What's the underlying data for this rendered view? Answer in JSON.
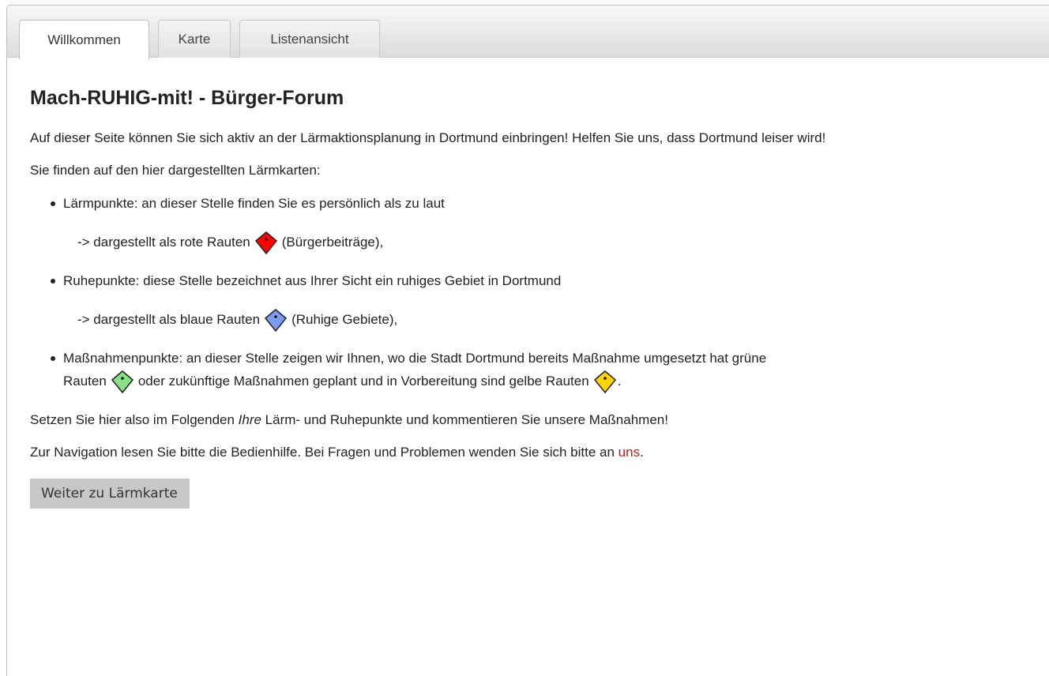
{
  "tabs": [
    {
      "label": "Willkommen",
      "active": true
    },
    {
      "label": "Karte",
      "active": false
    },
    {
      "label": "Listenansicht",
      "active": false
    }
  ],
  "main": {
    "title": "Mach-RUHIG-mit! - Bürger-Forum",
    "intro": "Auf dieser Seite können Sie sich aktiv an der Lärmaktionsplanung in Dortmund einbringen! Helfen Sie uns, dass Dortmund leiser wird!",
    "list_intro": "Sie finden auf den hier dargestellten Lärmkarten:",
    "items": [
      {
        "text": "Lärmpunkte: an dieser Stelle finden Sie es persönlich als zu laut",
        "sub_prefix": "-> dargestellt als rote Rauten",
        "sub_suffix": "(Bürgerbeiträge),",
        "icon": "red-rhombus-marker-icon",
        "color": "#ff0000"
      },
      {
        "text": "Ruhepunkte: diese Stelle bezeichnet aus Ihrer Sicht ein ruhiges Gebiet in Dortmund",
        "sub_prefix": "-> dargestellt als blaue Rauten",
        "sub_suffix": "(Ruhige Gebiete),",
        "icon": "blue-rhombus-marker-icon",
        "color": "#7b9cf0"
      },
      {
        "text_line1": "Maßnahmenpunkte: an dieser Stelle zeigen wir Ihnen, wo die Stadt Dortmund bereits Maßnahme umgesetzt hat grüne",
        "text_line2a": "Rauten",
        "text_line2b": "oder zukünftige Maßnahmen geplant und in Vorbereitung sind gelbe Rauten",
        "text_line2c": ".",
        "icon_green": "green-rhombus-marker-icon",
        "color_green": "#88e088",
        "icon_yellow": "yellow-rhombus-marker-icon",
        "color_yellow": "#ffd400"
      }
    ],
    "outro1_a": "Setzen Sie hier also im Folgenden ",
    "outro1_em": "Ihre",
    "outro1_b": " Lärm- und Ruhepunkte und kommentieren Sie unsere Maßnahmen!",
    "outro2": "Zur Navigation lesen Sie bitte die Bedienhilfe. Bei Fragen und Problemen wenden Sie sich bitte an ",
    "outro2_link": "uns",
    "outro2_end": ".",
    "button_label": "Weiter zu Lärmkarte"
  }
}
